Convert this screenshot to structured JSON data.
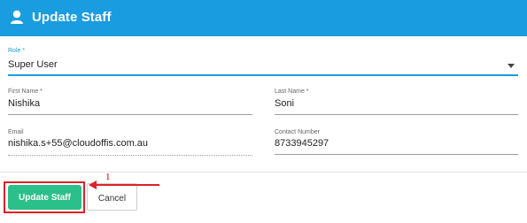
{
  "header": {
    "title": "Update Staff",
    "icon": "user-icon"
  },
  "form": {
    "role": {
      "label": "Role *",
      "value": "Super User"
    },
    "first_name": {
      "label": "First Name *",
      "value": "Nishika"
    },
    "last_name": {
      "label": "Last Name *",
      "value": "Soni"
    },
    "email": {
      "label": "Email",
      "value": "nishika.s+55@cloudoffis.com.au"
    },
    "contact_number": {
      "label": "Contact Number",
      "value": "8733945297"
    }
  },
  "actions": {
    "update_label": "Update Staff",
    "cancel_label": "Cancel"
  },
  "annotation": {
    "step": "1"
  },
  "colors": {
    "header": "#1a9ce0",
    "primary": "#2bbf8a",
    "highlight": "#e01f26"
  }
}
